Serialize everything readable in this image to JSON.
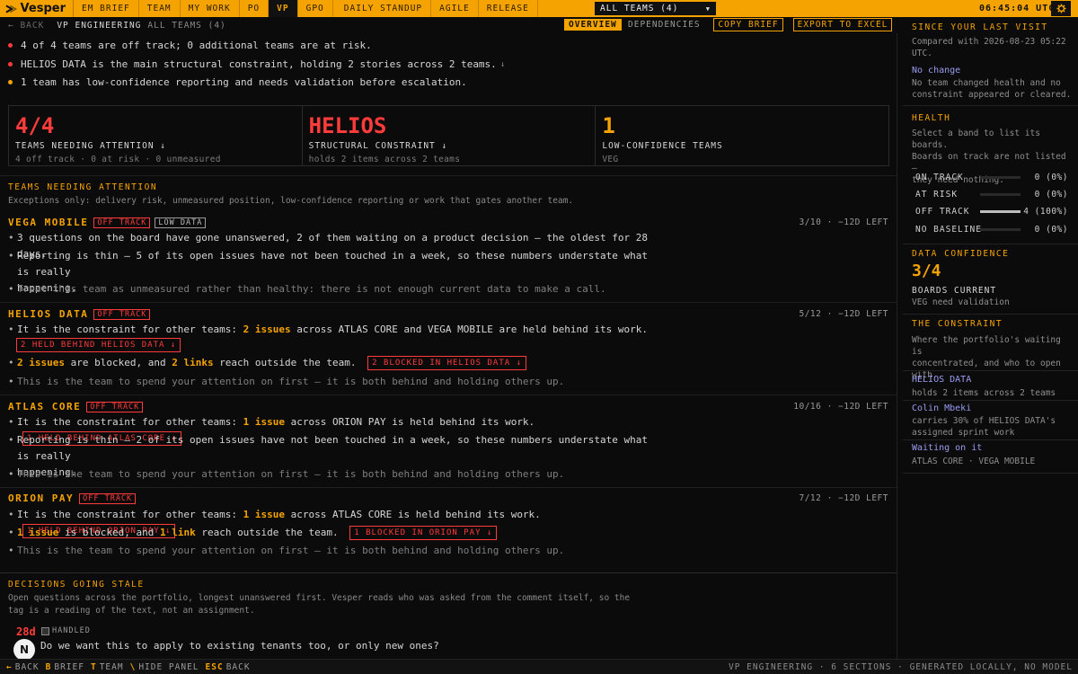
{
  "app": {
    "name": "Vesper",
    "clock": "06:45:04 UTC"
  },
  "nav": {
    "tabs": [
      "EM BRIEF",
      "TEAM",
      "MY WORK",
      "PO",
      "VP",
      "GPO",
      "DAILY STANDUP",
      "AGILE",
      "RELEASE"
    ],
    "team_select": "ALL TEAMS (4)"
  },
  "subheader": {
    "back": "← BACK",
    "role": "VP ENGINEERING",
    "scope": "ALL TEAMS (4)",
    "tab_overview": "OVERVIEW",
    "tab_dependencies": "DEPENDENCIES",
    "copy_brief": "COPY BRIEF",
    "export": "EXPORT TO EXCEL"
  },
  "summary": [
    "4 of 4 teams are off track; 0 additional teams are at risk.",
    "HELIOS DATA is the main structural constraint, holding 2 stories across 2 teams.",
    "1 team has low-confidence reporting and needs validation before escalation."
  ],
  "stats": [
    {
      "value": "4/4",
      "label": "TEAMS NEEDING ATTENTION ↓",
      "sub": "4 off track · 0 at risk · 0 unmeasured"
    },
    {
      "value": "HELIOS",
      "label": "STRUCTURAL CONSTRAINT ↓",
      "sub": "holds 2 items across 2 teams"
    },
    {
      "value": "1",
      "label": "LOW-CONFIDENCE TEAMS",
      "sub": "VEG"
    }
  ],
  "attention": {
    "title": "TEAMS NEEDING ATTENTION",
    "desc": "Exceptions only: delivery risk, unmeasured position, low-confidence reporting or work that gates another team.",
    "teams": [
      {
        "name": "VEGA MOBILE",
        "tag1": "OFF TRACK",
        "tag2": "LOW DATA",
        "meta": "3/10 · −12D LEFT",
        "l1": "3 questions on the board have gone unanswered, 2 of them waiting on a product decision — the oldest for 28 days.",
        "l2a": "Reporting is thin — 5 of its open issues have not been touched in a week, so these numbers understate what is really",
        "l2b": "happening.",
        "l3": "Treat this team as unmeasured rather than healthy: there is not enough current data to make a call."
      },
      {
        "name": "HELIOS DATA",
        "tag1": "OFF TRACK",
        "meta": "5/12 · −12D LEFT",
        "l1_pre": "It is the constraint for other teams:",
        "l1_hl": "2 issues",
        "l1_post": "across ATLAS CORE and VEGA MOBILE are held behind its work.",
        "chip_held": "2 HELD BEHIND HELIOS DATA ↓",
        "l2_hl1": "2 issues",
        "l2_mid": "are blocked, and",
        "l2_hl2": "2 links",
        "l2_post": "reach outside the team.",
        "chip_blocked": "2 BLOCKED IN HELIOS DATA ↓",
        "l3": "This is the team to spend your attention on first — it is both behind and holding others up."
      },
      {
        "name": "ATLAS CORE",
        "tag1": "OFF TRACK",
        "meta": "10/16 · −12D LEFT",
        "l1_pre": "It is the constraint for other teams:",
        "l1_hl": "1 issue",
        "l1_post": "across ORION PAY is held behind its work.",
        "chip_held": "1 HELD BEHIND ATLAS CORE ↓",
        "l2a": "Reporting is thin — 2 of its open issues have not been touched in a week, so these numbers understate what is really",
        "l2b": "happening.",
        "l3": "This is the team to spend your attention on first — it is both behind and holding others up."
      },
      {
        "name": "ORION PAY",
        "tag1": "OFF TRACK",
        "meta": "7/12 · −12D LEFT",
        "l1_pre": "It is the constraint for other teams:",
        "l1_hl": "1 issue",
        "l1_post": "across ATLAS CORE is held behind its work.",
        "chip_held": "1 HELD BEHIND ORION PAY ↓",
        "l2_hl1": "1 issue",
        "l2_mid": "is blocked, and",
        "l2_hl2": "1 link",
        "l2_post": "reach outside the team.",
        "chip_blocked": "1 BLOCKED IN ORION PAY ↓",
        "l3": "This is the team to spend your attention on first — it is both behind and holding others up."
      }
    ]
  },
  "stale": {
    "title": "DECISIONS GOING STALE",
    "desc1": "Open questions across the portfolio, longest unanswered first. Vesper reads who was asked from the comment itself, so the",
    "desc2": "tag is a reading of the text, not an assignment.",
    "age": "28d",
    "handled": "HANDLED",
    "question": "Do we want this to apply to existing tenants too, or only new ones?",
    "assistant_button": "N"
  },
  "side": {
    "since_title": "SINCE YOUR LAST VISIT",
    "since_text1": "Compared with 2026-08-23 05:22",
    "since_text2": "UTC.",
    "no_change": "No change",
    "no_change_text1": "No team changed health and no",
    "no_change_text2": "constraint appeared or cleared.",
    "health_title": "HEALTH",
    "health_text1": "Select a band to list its boards.",
    "health_text2": "Boards on track are not listed —",
    "health_text3": "they need nothing.",
    "bands": [
      {
        "label": "ON TRACK",
        "value": "0 (0%)",
        "share": 0
      },
      {
        "label": "AT RISK",
        "value": "0 (0%)",
        "share": 0
      },
      {
        "label": "OFF TRACK",
        "value": "4 (100%)",
        "share": 1
      },
      {
        "label": "NO BASELINE",
        "value": "0 (0%)",
        "share": 0
      }
    ],
    "conf_title": "DATA CONFIDENCE",
    "conf_value": "3/4",
    "conf_label": "BOARDS CURRENT",
    "conf_sub": "VEG need validation",
    "constraint_title": "THE CONSTRAINT",
    "constraint_text1": "Where the portfolio's waiting is",
    "constraint_text2": "concentrated, and who to open",
    "constraint_text3": "with.",
    "c_team": "HELIOS DATA",
    "c_team_sub": "holds 2 items across 2 teams",
    "c_person": "Colin Mbeki",
    "c_person_sub1": "carries 30% of HELIOS DATA's",
    "c_person_sub2": "assigned sprint work",
    "c_waiting": "Waiting on it",
    "c_waiting_sub": "ATLAS CORE · VEGA MOBILE"
  },
  "bottom": {
    "shortcuts": [
      {
        "key": "←",
        "label": "BACK"
      },
      {
        "key": "B",
        "label": "BRIEF"
      },
      {
        "key": "T",
        "label": "TEAM"
      },
      {
        "key": "\\",
        "label": "HIDE PANEL"
      },
      {
        "key": "ESC",
        "label": "BACK"
      }
    ],
    "status": "VP ENGINEERING · 6 SECTIONS · GENERATED LOCALLY, NO MODEL"
  },
  "colors": {
    "accent": "#f5a300",
    "danger": "#ff3b3b",
    "link": "#9a9cf0",
    "background": "#0b0b0b"
  },
  "icons": [
    "vesper-logo-icon",
    "gear-icon",
    "chevron-down-icon",
    "checkbox-icon"
  ]
}
